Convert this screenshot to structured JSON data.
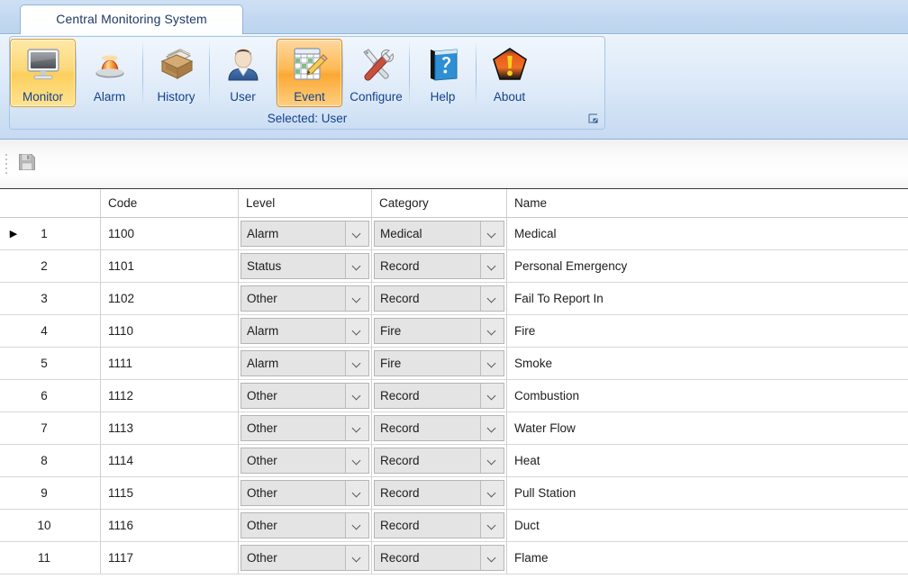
{
  "window": {
    "title": "Central Monitoring System"
  },
  "ribbon": {
    "tab_label": "Central Monitoring System",
    "buttons": [
      {
        "label": "Monitor",
        "icon": "monitor-icon",
        "state": "selected-gold"
      },
      {
        "label": "Alarm",
        "icon": "alarm-light-icon",
        "state": "normal"
      },
      {
        "label": "History",
        "icon": "file-box-icon",
        "state": "normal"
      },
      {
        "label": "User",
        "icon": "user-icon",
        "state": "normal"
      },
      {
        "label": "Event",
        "icon": "calendar-edit-icon",
        "state": "selected-orange"
      },
      {
        "label": "Configure",
        "icon": "tools-icon",
        "state": "normal"
      },
      {
        "label": "Help",
        "icon": "help-book-icon",
        "state": "normal"
      },
      {
        "label": "About",
        "icon": "warning-pentagon-icon",
        "state": "normal"
      }
    ],
    "status_label": "Selected: User",
    "dialog_launcher_icon": "dialog-launcher-icon",
    "accent_gold": "#fbcf5c",
    "accent_orange": "#fba832",
    "text_color": "#15428b"
  },
  "toolbar": {
    "grip_icon": "drag-grip-icon",
    "save_icon": "save-floppy-icon",
    "save_enabled": false
  },
  "grid": {
    "columns": [
      "",
      "Code",
      "Level",
      "Category",
      "Name"
    ],
    "selected_row": 1,
    "row_pointer_glyph": "▶",
    "rows": [
      {
        "n": "1",
        "code": "1100",
        "level": "Alarm",
        "category": "Medical",
        "name": "Medical"
      },
      {
        "n": "2",
        "code": "1101",
        "level": "Status",
        "category": "Record",
        "name": "Personal Emergency"
      },
      {
        "n": "3",
        "code": "1102",
        "level": "Other",
        "category": "Record",
        "name": "Fail To Report In"
      },
      {
        "n": "4",
        "code": "1110",
        "level": "Alarm",
        "category": "Fire",
        "name": "Fire"
      },
      {
        "n": "5",
        "code": "1111",
        "level": "Alarm",
        "category": "Fire",
        "name": "Smoke"
      },
      {
        "n": "6",
        "code": "1112",
        "level": "Other",
        "category": "Record",
        "name": "Combustion"
      },
      {
        "n": "7",
        "code": "1113",
        "level": "Other",
        "category": "Record",
        "name": "Water Flow"
      },
      {
        "n": "8",
        "code": "1114",
        "level": "Other",
        "category": "Record",
        "name": "Heat"
      },
      {
        "n": "9",
        "code": "1115",
        "level": "Other",
        "category": "Record",
        "name": "Pull Station"
      },
      {
        "n": "10",
        "code": "1116",
        "level": "Other",
        "category": "Record",
        "name": "Duct"
      },
      {
        "n": "11",
        "code": "1117",
        "level": "Other",
        "category": "Record",
        "name": "Flame"
      }
    ]
  }
}
